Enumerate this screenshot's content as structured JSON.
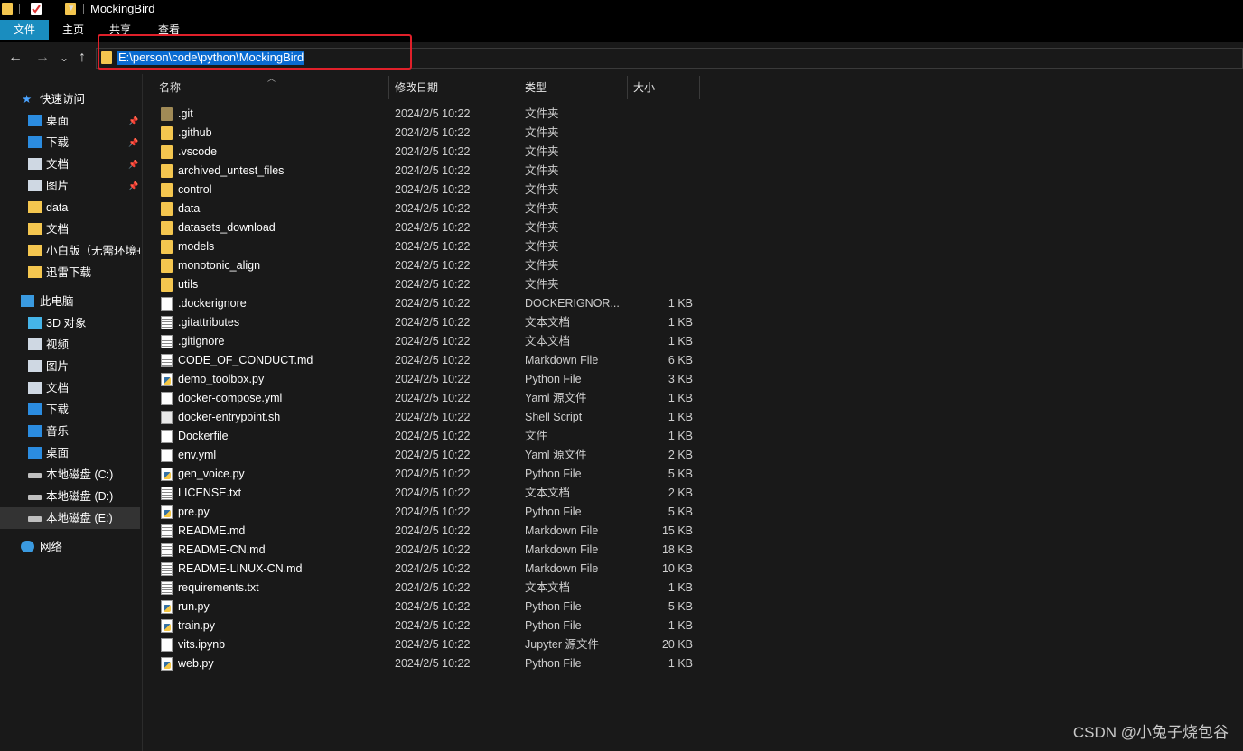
{
  "window": {
    "title": "MockingBird"
  },
  "ribbon": {
    "tabs": [
      "文件",
      "主页",
      "共享",
      "查看"
    ]
  },
  "address": {
    "path": "E:\\person\\code\\python\\MockingBird"
  },
  "nav_buttons": {
    "back": "←",
    "forward": "→",
    "recent": "⌄",
    "up": "↑"
  },
  "sidebar": {
    "quick_access": {
      "label": "快速访问",
      "items": [
        {
          "label": "桌面",
          "icon": "desktop-icon",
          "pinned": true
        },
        {
          "label": "下载",
          "icon": "download-icon",
          "pinned": true
        },
        {
          "label": "文档",
          "icon": "document-icon",
          "pinned": true
        },
        {
          "label": "图片",
          "icon": "pictures-icon",
          "pinned": true
        },
        {
          "label": "data",
          "icon": "folder-icon",
          "pinned": false
        },
        {
          "label": "文档",
          "icon": "folder-icon",
          "pinned": false
        },
        {
          "label": "小白版（无需环境+",
          "icon": "folder-icon",
          "pinned": false
        },
        {
          "label": "迅雷下载",
          "icon": "folder-icon",
          "pinned": false
        }
      ]
    },
    "this_pc": {
      "label": "此电脑",
      "items": [
        {
          "label": "3D 对象",
          "icon": "3d-objects-icon"
        },
        {
          "label": "视频",
          "icon": "video-icon"
        },
        {
          "label": "图片",
          "icon": "pictures-icon"
        },
        {
          "label": "文档",
          "icon": "document-icon"
        },
        {
          "label": "下载",
          "icon": "download-icon"
        },
        {
          "label": "音乐",
          "icon": "music-icon"
        },
        {
          "label": "桌面",
          "icon": "desktop-icon"
        },
        {
          "label": "本地磁盘 (C:)",
          "icon": "drive-icon"
        },
        {
          "label": "本地磁盘 (D:)",
          "icon": "drive-icon"
        },
        {
          "label": "本地磁盘 (E:)",
          "icon": "drive-icon",
          "selected": true
        }
      ]
    },
    "network": {
      "label": "网络"
    }
  },
  "columns": {
    "name": "名称",
    "date": "修改日期",
    "type": "类型",
    "size": "大小"
  },
  "files": [
    {
      "name": ".git",
      "date": "2024/2/5 10:22",
      "type": "文件夹",
      "size": "",
      "icon": "folder-hidden"
    },
    {
      "name": ".github",
      "date": "2024/2/5 10:22",
      "type": "文件夹",
      "size": "",
      "icon": "folder"
    },
    {
      "name": ".vscode",
      "date": "2024/2/5 10:22",
      "type": "文件夹",
      "size": "",
      "icon": "folder"
    },
    {
      "name": "archived_untest_files",
      "date": "2024/2/5 10:22",
      "type": "文件夹",
      "size": "",
      "icon": "folder"
    },
    {
      "name": "control",
      "date": "2024/2/5 10:22",
      "type": "文件夹",
      "size": "",
      "icon": "folder"
    },
    {
      "name": "data",
      "date": "2024/2/5 10:22",
      "type": "文件夹",
      "size": "",
      "icon": "folder"
    },
    {
      "name": "datasets_download",
      "date": "2024/2/5 10:22",
      "type": "文件夹",
      "size": "",
      "icon": "folder"
    },
    {
      "name": "models",
      "date": "2024/2/5 10:22",
      "type": "文件夹",
      "size": "",
      "icon": "folder"
    },
    {
      "name": "monotonic_align",
      "date": "2024/2/5 10:22",
      "type": "文件夹",
      "size": "",
      "icon": "folder"
    },
    {
      "name": "utils",
      "date": "2024/2/5 10:22",
      "type": "文件夹",
      "size": "",
      "icon": "folder"
    },
    {
      "name": ".dockerignore",
      "date": "2024/2/5 10:22",
      "type": "DOCKERIGNOR...",
      "size": "1 KB",
      "icon": "file"
    },
    {
      "name": ".gitattributes",
      "date": "2024/2/5 10:22",
      "type": "文本文档",
      "size": "1 KB",
      "icon": "text"
    },
    {
      "name": ".gitignore",
      "date": "2024/2/5 10:22",
      "type": "文本文档",
      "size": "1 KB",
      "icon": "text"
    },
    {
      "name": "CODE_OF_CONDUCT.md",
      "date": "2024/2/5 10:22",
      "type": "Markdown File",
      "size": "6 KB",
      "icon": "text"
    },
    {
      "name": "demo_toolbox.py",
      "date": "2024/2/5 10:22",
      "type": "Python File",
      "size": "3 KB",
      "icon": "python"
    },
    {
      "name": "docker-compose.yml",
      "date": "2024/2/5 10:22",
      "type": "Yaml 源文件",
      "size": "1 KB",
      "icon": "yaml"
    },
    {
      "name": "docker-entrypoint.sh",
      "date": "2024/2/5 10:22",
      "type": "Shell Script",
      "size": "1 KB",
      "icon": "shell"
    },
    {
      "name": "Dockerfile",
      "date": "2024/2/5 10:22",
      "type": "文件",
      "size": "1 KB",
      "icon": "file"
    },
    {
      "name": "env.yml",
      "date": "2024/2/5 10:22",
      "type": "Yaml 源文件",
      "size": "2 KB",
      "icon": "yaml"
    },
    {
      "name": "gen_voice.py",
      "date": "2024/2/5 10:22",
      "type": "Python File",
      "size": "5 KB",
      "icon": "python"
    },
    {
      "name": "LICENSE.txt",
      "date": "2024/2/5 10:22",
      "type": "文本文档",
      "size": "2 KB",
      "icon": "text"
    },
    {
      "name": "pre.py",
      "date": "2024/2/5 10:22",
      "type": "Python File",
      "size": "5 KB",
      "icon": "python"
    },
    {
      "name": "README.md",
      "date": "2024/2/5 10:22",
      "type": "Markdown File",
      "size": "15 KB",
      "icon": "text"
    },
    {
      "name": "README-CN.md",
      "date": "2024/2/5 10:22",
      "type": "Markdown File",
      "size": "18 KB",
      "icon": "text"
    },
    {
      "name": "README-LINUX-CN.md",
      "date": "2024/2/5 10:22",
      "type": "Markdown File",
      "size": "10 KB",
      "icon": "text"
    },
    {
      "name": "requirements.txt",
      "date": "2024/2/5 10:22",
      "type": "文本文档",
      "size": "1 KB",
      "icon": "text"
    },
    {
      "name": "run.py",
      "date": "2024/2/5 10:22",
      "type": "Python File",
      "size": "5 KB",
      "icon": "python"
    },
    {
      "name": "train.py",
      "date": "2024/2/5 10:22",
      "type": "Python File",
      "size": "1 KB",
      "icon": "python"
    },
    {
      "name": "vits.ipynb",
      "date": "2024/2/5 10:22",
      "type": "Jupyter 源文件",
      "size": "20 KB",
      "icon": "file"
    },
    {
      "name": "web.py",
      "date": "2024/2/5 10:22",
      "type": "Python File",
      "size": "1 KB",
      "icon": "python"
    }
  ],
  "watermark": "CSDN @小兔子烧包谷",
  "colors": {
    "accent": "#1a8dbf",
    "selection": "#0a6bd1",
    "highlight_box": "#e0202a",
    "folder": "#f4c64f"
  }
}
